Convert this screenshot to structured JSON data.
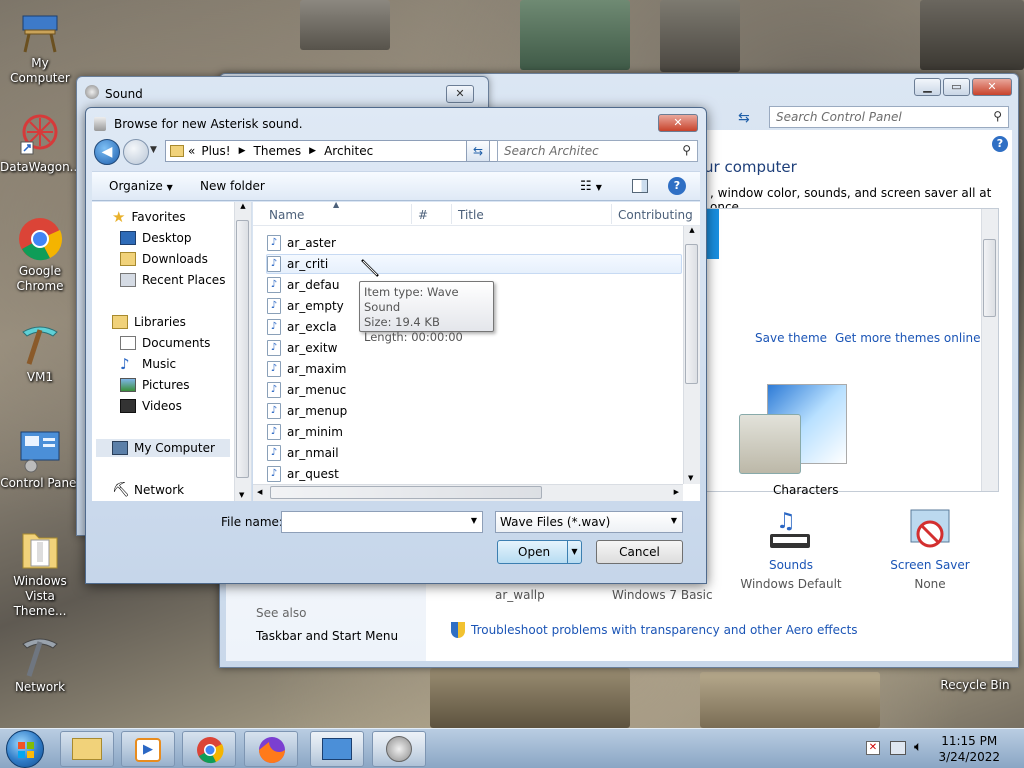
{
  "desktop": {
    "icons": [
      {
        "label": "My Computer"
      },
      {
        "label": "DataWagon..."
      },
      {
        "label": "Google Chrome"
      },
      {
        "label": "VM1"
      },
      {
        "label": "Control Panel"
      },
      {
        "label": "Windows Vista Theme..."
      },
      {
        "label": "Network"
      },
      {
        "label": "Recycle Bin"
      }
    ]
  },
  "control_panel": {
    "search_placeholder": "Search Control Panel",
    "heading": "ur computer",
    "subtitle": ", window color, sounds, and screen saver all at once.",
    "links": {
      "save_theme": "Save theme",
      "more_themes": "Get more themes online"
    },
    "theme_caption": "Characters",
    "bottom": {
      "wallp": "ar_wallp",
      "color": "Windows 7 Basic",
      "sounds_label": "Sounds",
      "sounds_value": "Windows Default",
      "saver_label": "Screen Saver",
      "saver_value": "None"
    },
    "see_also": "See also",
    "taskbar_link": "Taskbar and Start Menu",
    "troubleshoot": "Troubleshoot problems with transparency and other Aero effects"
  },
  "sound_dialog": {
    "title": "Sound"
  },
  "browse": {
    "title": "Browse for new Asterisk sound.",
    "breadcrumb": [
      "«",
      "Plus!",
      "Themes",
      "Architec"
    ],
    "search_placeholder": "Search Architec",
    "toolbar": {
      "organize": "Organize",
      "new_folder": "New folder"
    },
    "nav": {
      "favorites": "Favorites",
      "desktop": "Desktop",
      "downloads": "Downloads",
      "recent": "Recent Places",
      "libraries": "Libraries",
      "documents": "Documents",
      "music": "Music",
      "pictures": "Pictures",
      "videos": "Videos",
      "computer": "My Computer",
      "network": "Network"
    },
    "columns": {
      "name": "Name",
      "num": "#",
      "title": "Title",
      "contributing": "Contributing"
    },
    "files": [
      "ar_aster",
      "ar_criti",
      "ar_defau",
      "ar_empty",
      "ar_excla",
      "ar_exitw",
      "ar_maxim",
      "ar_menuc",
      "ar_menup",
      "ar_minim",
      "ar_nmail",
      "ar_quest"
    ],
    "tooltip": {
      "type": "Item type: Wave Sound",
      "size": "Size: 19.4 KB",
      "length": "Length: 00:00:00"
    },
    "file_name_label": "File name:",
    "file_name_value": "",
    "filter": "Wave Files (*.wav)",
    "open": "Open",
    "cancel": "Cancel"
  },
  "taskbar": {
    "time": "11:15 PM",
    "date": "3/24/2022"
  },
  "colors": {
    "link": "#1b55b6",
    "title_bar": "#dbe6f3",
    "close": "#c8432b"
  }
}
